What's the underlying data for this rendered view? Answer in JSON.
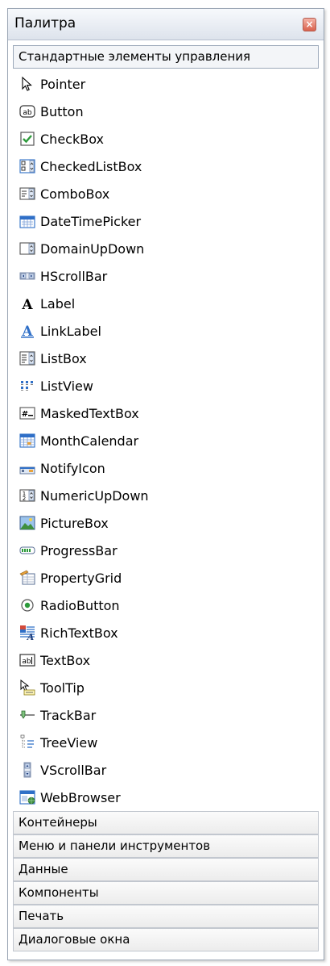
{
  "panel": {
    "title": "Палитра",
    "close_glyph": "×"
  },
  "groups": {
    "standard": {
      "label": "Стандартные элементы управления",
      "items": [
        {
          "label": "Pointer",
          "icon": "pointer-icon"
        },
        {
          "label": "Button",
          "icon": "button-icon"
        },
        {
          "label": "CheckBox",
          "icon": "checkbox-icon"
        },
        {
          "label": "CheckedListBox",
          "icon": "checkedlistbox-icon"
        },
        {
          "label": "ComboBox",
          "icon": "combobox-icon"
        },
        {
          "label": "DateTimePicker",
          "icon": "datetimepicker-icon"
        },
        {
          "label": "DomainUpDown",
          "icon": "domainupdown-icon"
        },
        {
          "label": "HScrollBar",
          "icon": "hscrollbar-icon"
        },
        {
          "label": "Label",
          "icon": "label-icon"
        },
        {
          "label": "LinkLabel",
          "icon": "linklabel-icon"
        },
        {
          "label": "ListBox",
          "icon": "listbox-icon"
        },
        {
          "label": "ListView",
          "icon": "listview-icon"
        },
        {
          "label": "MaskedTextBox",
          "icon": "maskedtextbox-icon"
        },
        {
          "label": "MonthCalendar",
          "icon": "monthcalendar-icon"
        },
        {
          "label": "NotifyIcon",
          "icon": "notifyicon-icon"
        },
        {
          "label": "NumericUpDown",
          "icon": "numericupdown-icon"
        },
        {
          "label": "PictureBox",
          "icon": "picturebox-icon"
        },
        {
          "label": "ProgressBar",
          "icon": "progressbar-icon"
        },
        {
          "label": "PropertyGrid",
          "icon": "propertygrid-icon"
        },
        {
          "label": "RadioButton",
          "icon": "radiobutton-icon"
        },
        {
          "label": "RichTextBox",
          "icon": "richtextbox-icon"
        },
        {
          "label": "TextBox",
          "icon": "textbox-icon"
        },
        {
          "label": "ToolTip",
          "icon": "tooltip-icon"
        },
        {
          "label": "TrackBar",
          "icon": "trackbar-icon"
        },
        {
          "label": "TreeView",
          "icon": "treeview-icon"
        },
        {
          "label": "VScrollBar",
          "icon": "vscrollbar-icon"
        },
        {
          "label": "WebBrowser",
          "icon": "webbrowser-icon"
        }
      ]
    },
    "collapsed": [
      {
        "label": "Контейнеры"
      },
      {
        "label": "Меню и панели инструментов"
      },
      {
        "label": "Данные"
      },
      {
        "label": "Компоненты"
      },
      {
        "label": "Печать"
      },
      {
        "label": "Диалоговые окна"
      }
    ]
  },
  "colors": {
    "accent_blue": "#2f6fc7",
    "check_green": "#2c9a3a",
    "close_red": "#d9614c"
  }
}
